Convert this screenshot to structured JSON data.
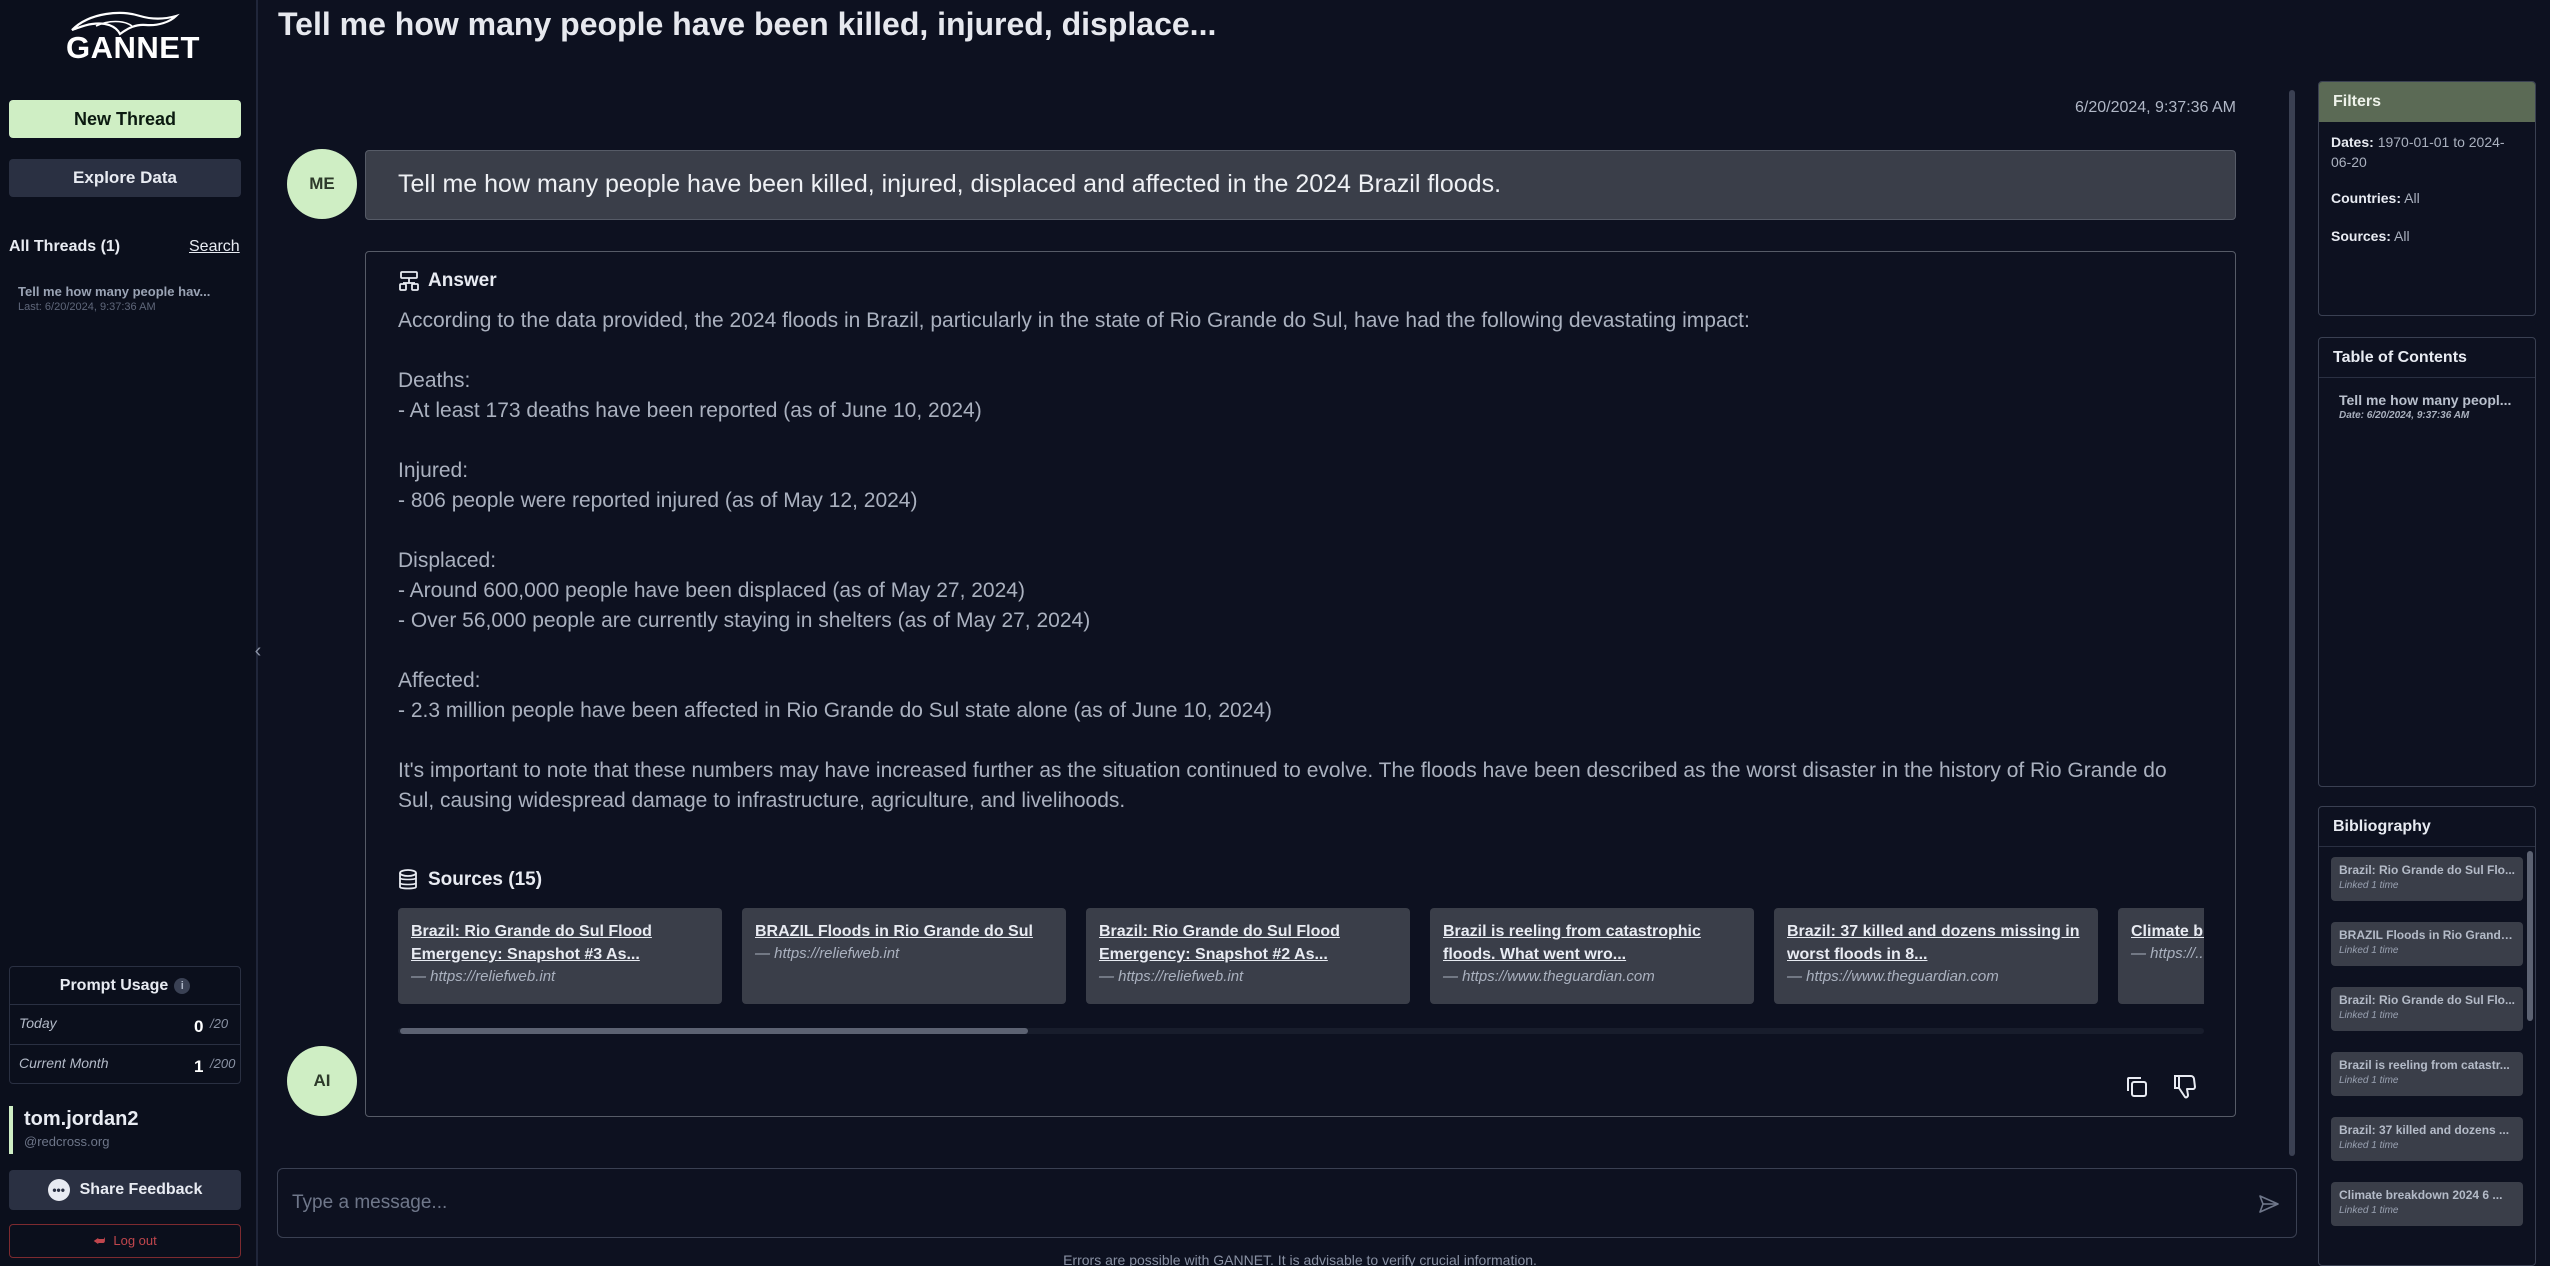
{
  "sidebar": {
    "logo_text": "GANNET",
    "new_thread": "New Thread",
    "explore_data": "Explore Data",
    "threads_header": "All Threads (1)",
    "search_link": "Search",
    "threads": [
      {
        "title": "Tell me how many people hav...",
        "subtitle": "Last: 6/20/2024, 9:37:36 AM"
      }
    ],
    "prompt_usage": {
      "title": "Prompt Usage",
      "today_label": "Today",
      "today_value": "0",
      "today_max": "/20",
      "month_label": "Current Month",
      "month_value": "1",
      "month_max": "/200"
    },
    "user": {
      "name": "tom.jordan2",
      "email": "@redcross.org"
    },
    "share_feedback": "Share Feedback",
    "logout": "Log out"
  },
  "main": {
    "title": "Tell me how many people have been killed, injured, displace...",
    "timestamp": "6/20/2024, 9:37:36 AM",
    "user_avatar": "ME",
    "ai_avatar": "AI",
    "user_message": "Tell me how many people have been killed, injured, displaced and affected in the 2024 Brazil floods.",
    "answer_label": "Answer",
    "answer": {
      "intro": "According to the data provided, the 2024 floods in Brazil, particularly in the state of Rio Grande do Sul, have had the following devastating impact:",
      "deaths_h": "Deaths:",
      "deaths_1": "- At least 173 deaths have been reported (as of June 10, 2024)",
      "injured_h": "Injured:",
      "injured_1": "- 806 people were reported injured (as of May 12, 2024)",
      "displaced_h": "Displaced:",
      "displaced_1": "- Around 600,000 people have been displaced (as of May 27, 2024)",
      "displaced_2": "- Over 56,000 people are currently staying in shelters (as of May 27, 2024)",
      "affected_h": "Affected:",
      "affected_1": "- 2.3 million people have been affected in Rio Grande do Sul state alone (as of June 10, 2024)",
      "closing": "It's important to note that these numbers may have increased further as the situation continued to evolve. The floods have been described as the worst disaster in the history of Rio Grande do Sul, causing widespread damage to infrastructure, agriculture, and livelihoods."
    },
    "sources_label": "Sources (15)",
    "sources": [
      {
        "title": "Brazil: Rio Grande do Sul Flood Emergency: Snapshot #3 As...",
        "url": "— https://reliefweb.int"
      },
      {
        "title": "BRAZIL Floods in Rio Grande do Sul",
        "url": "— https://reliefweb.int"
      },
      {
        "title": "Brazil: Rio Grande do Sul Flood Emergency: Snapshot #2 As...",
        "url": "— https://reliefweb.int"
      },
      {
        "title": "Brazil is reeling from catastrophic floods. What went wro...",
        "url": "— https://www.theguardian.com"
      },
      {
        "title": "Brazil: 37 killed and dozens missing in worst floods in 8...",
        "url": "— https://www.theguardian.com"
      },
      {
        "title": "Climate b... climate c...",
        "url": "— https://..."
      }
    ],
    "composer_placeholder": "Type a message...",
    "disclaimer": "Errors are possible with GANNET. It is advisable to verify crucial information."
  },
  "right_panel": {
    "filters_title": "Filters",
    "dates_label": "Dates:",
    "dates_value": "1970-01-01 to 2024-06-20",
    "countries_label": "Countries:",
    "countries_value": "All",
    "sources_label": "Sources:",
    "sources_value": "All",
    "toc_title": "Table of Contents",
    "toc_items": [
      {
        "title": "Tell me how many peopl...",
        "date": "Date: 6/20/2024, 9:37:36 AM"
      }
    ],
    "bibliography_title": "Bibliography",
    "bibliography": [
      {
        "title": "Brazil: Rio Grande do Sul Flo...",
        "linked": "Linked 1 time"
      },
      {
        "title": "BRAZIL Floods in Rio Grande...",
        "linked": "Linked 1 time"
      },
      {
        "title": "Brazil: Rio Grande do Sul Flo...",
        "linked": "Linked 1 time"
      },
      {
        "title": "Brazil is reeling from catastr...",
        "linked": "Linked 1 time"
      },
      {
        "title": "Brazil: 37 killed and dozens ...",
        "linked": "Linked 1 time"
      },
      {
        "title": "Climate breakdown 2024 6 ...",
        "linked": "Linked 1 time"
      }
    ]
  },
  "colors": {
    "background": "#0d1120",
    "accent_green": "#cfeec4",
    "card": "#3a3e49",
    "logout_red": "#c0464d"
  }
}
